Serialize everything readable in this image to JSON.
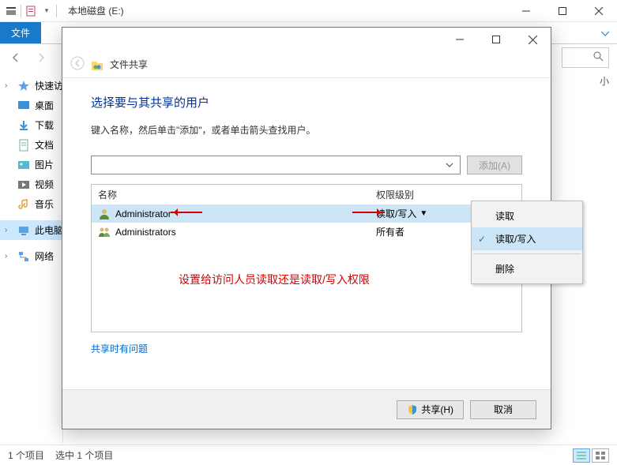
{
  "explorer": {
    "title": "本地磁盘 (E:)",
    "tabs": {
      "file": "文件"
    },
    "header_col": "小",
    "sidebar": [
      {
        "icon": "star",
        "label": "快速访",
        "caret": true
      },
      {
        "icon": "desktop",
        "label": "桌面"
      },
      {
        "icon": "download",
        "label": "下载"
      },
      {
        "icon": "doc",
        "label": "文档"
      },
      {
        "icon": "pic",
        "label": "图片"
      },
      {
        "icon": "video",
        "label": "视频"
      },
      {
        "icon": "music",
        "label": "音乐"
      },
      {
        "icon": "pc",
        "label": "此电脑",
        "sel": true,
        "caret": true
      },
      {
        "icon": "net",
        "label": "网络",
        "caret": true
      }
    ],
    "status": {
      "items": "1 个项目",
      "selected": "选中 1 个项目"
    }
  },
  "dialog": {
    "title": "文件共享",
    "heading": "选择要与其共享的用户",
    "desc": "键入名称，然后单击\"添加\"，或者单击箭头查找用户。",
    "add_btn": "添加(A)",
    "columns": {
      "name": "名称",
      "perm": "权限级别"
    },
    "rows": [
      {
        "icon": "user",
        "name": "Administrator",
        "perm": "读取/写入",
        "dd": true,
        "sel": true
      },
      {
        "icon": "group",
        "name": "Administrators",
        "perm": "所有者"
      }
    ],
    "menu": {
      "read": "读取",
      "readwrite": "读取/写入",
      "remove": "删除"
    },
    "annotation": "设置给访问人员读取还是读取/写入权限",
    "help_link": "共享时有问题",
    "share_btn": "共享(H)",
    "cancel_btn": "取消"
  }
}
